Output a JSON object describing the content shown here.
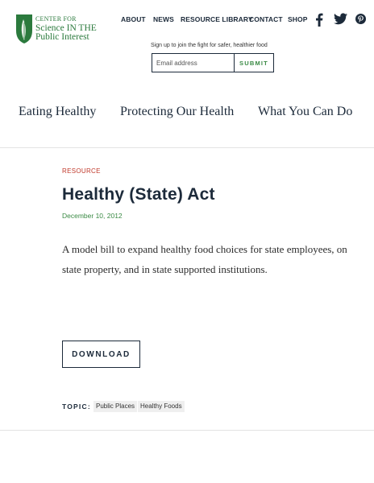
{
  "logo": {
    "line1": "CENTER FOR",
    "line2": "Science IN THE",
    "line3": "Public Interest",
    "brand_color": "#2b7a3d"
  },
  "top_nav": {
    "items": [
      "ABOUT",
      "NEWS",
      "RESOURCE LIBRARY",
      "CONTACT",
      "SHOP"
    ]
  },
  "social": {
    "icons": [
      "facebook-icon",
      "twitter-icon",
      "pinterest-icon"
    ]
  },
  "signup": {
    "prompt": "Sign up to join the fight for safer, healthier food",
    "email_placeholder": "Email address",
    "email_value": "",
    "submit_label": "SUBMIT"
  },
  "main_nav": {
    "items": [
      "Eating Healthy",
      "Protecting Our Health",
      "What You Can Do"
    ]
  },
  "article": {
    "type": "RESOURCE",
    "title": "Healthy (State) Act",
    "date": "December 10, 2012",
    "description": "A model bill to expand healthy food choices for state employees, on state property, and in state supported institutions.",
    "download_label": "DOWNLOAD",
    "topic_label": "TOPIC:",
    "topics": [
      "Public Places",
      "Healthy Foods"
    ]
  },
  "colors": {
    "accent_green": "#3a8a44",
    "label_red": "#c0392b",
    "navy": "#1c2a3a"
  }
}
